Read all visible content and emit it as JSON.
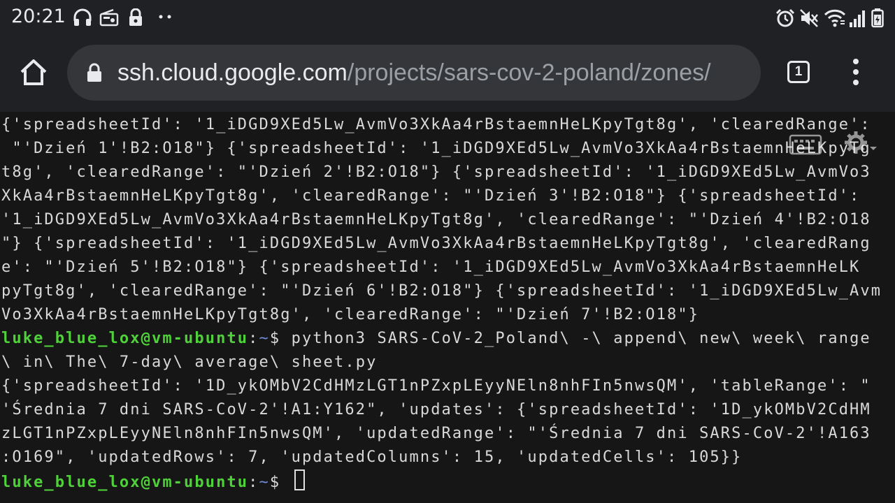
{
  "status_bar": {
    "time": "20:21",
    "left_icons": [
      "headphones-icon",
      "radio-icon",
      "lock-icon",
      "more-dots-icon"
    ],
    "right_icons": [
      "alarm-icon",
      "mute-icon",
      "wifi-icon",
      "signal-icon",
      "battery-icon"
    ]
  },
  "browser": {
    "url_host": "ssh.cloud.google.com",
    "url_path": "/projects/sars-cov-2-poland/zones/",
    "tab_count": "1"
  },
  "terminal": {
    "rows": [
      [
        {
          "t": "text",
          "v": "{'spreadsheetId': '1_iDGD9XEd5Lw_AvmVo3XkAa4rBstaemnHeLKpyTgt8g', 'clearedRange':"
        }
      ],
      [
        {
          "t": "text",
          "v": " \"'Dzień 1'!B2:O18\"} {'spreadsheetId': '1_iDGD9XEd5Lw_AvmVo3XkAa4rBstaemnHeLKpyTg"
        }
      ],
      [
        {
          "t": "text",
          "v": "t8g', 'clearedRange': \"'Dzień 2'!B2:O18\"} {'spreadsheetId': '1_iDGD9XEd5Lw_AvmVo3"
        }
      ],
      [
        {
          "t": "text",
          "v": "XkAa4rBstaemnHeLKpyTgt8g', 'clearedRange': \"'Dzień 3'!B2:O18\"} {'spreadsheetId':"
        }
      ],
      [
        {
          "t": "text",
          "v": "'1_iDGD9XEd5Lw_AvmVo3XkAa4rBstaemnHeLKpyTgt8g', 'clearedRange': \"'Dzień 4'!B2:O18"
        }
      ],
      [
        {
          "t": "text",
          "v": "\"} {'spreadsheetId': '1_iDGD9XEd5Lw_AvmVo3XkAa4rBstaemnHeLKpyTgt8g', 'clearedRang"
        }
      ],
      [
        {
          "t": "text",
          "v": "e': \"'Dzień 5'!B2:O18\"} {'spreadsheetId': '1_iDGD9XEd5Lw_AvmVo3XkAa4rBstaemnHeLK"
        }
      ],
      [
        {
          "t": "text",
          "v": "pyTgt8g', 'clearedRange': \"'Dzień 6'!B2:O18\"} {'spreadsheetId': '1_iDGD9XEd5Lw_Avm"
        }
      ],
      [
        {
          "t": "text",
          "v": "Vo3XkAa4rBstaemnHeLKpyTgt8g', 'clearedRange': \"'Dzień 7'!B2:O18\"}"
        }
      ],
      [
        {
          "t": "user",
          "v": "luke_blue_lox@vm-ubuntu"
        },
        {
          "t": "text",
          "v": ":"
        },
        {
          "t": "path",
          "v": "~"
        },
        {
          "t": "text",
          "v": "$ python3 SARS-CoV-2_Poland\\ -\\ append\\ new\\ week\\ range"
        }
      ],
      [
        {
          "t": "text",
          "v": "\\ in\\ The\\ 7-day\\ average\\ sheet.py"
        }
      ],
      [
        {
          "t": "text",
          "v": "{'spreadsheetId': '1D_ykOMbV2CdHMzLGT1nPZxpLEyyNEln8nhFIn5nwsQM', 'tableRange': \""
        }
      ],
      [
        {
          "t": "text",
          "v": "'Średnia 7 dni SARS-CoV-2'!A1:Y162\", 'updates': {'spreadsheetId': '1D_ykOMbV2CdHM"
        }
      ],
      [
        {
          "t": "text",
          "v": "zLGT1nPZxpLEyyNEln8nhFIn5nwsQM', 'updatedRange': \"'Średnia 7 dni SARS-CoV-2'!A163"
        }
      ],
      [
        {
          "t": "text",
          "v": ":O169\", 'updatedRows': 7, 'updatedColumns': 15, 'updatedCells': 105}}"
        }
      ],
      [
        {
          "t": "user",
          "v": "luke_blue_lox@vm-ubuntu"
        },
        {
          "t": "text",
          "v": ":"
        },
        {
          "t": "path",
          "v": "~"
        },
        {
          "t": "text",
          "v": "$ "
        },
        {
          "t": "cursor",
          "v": ""
        }
      ]
    ]
  },
  "colors": {
    "terminal_bg": "#161616",
    "terminal_text": "#d9d9d9",
    "prompt_user": "#4fd13a",
    "prompt_path": "#6f8dd6",
    "toolbar_bg": "#202124",
    "omnibox_bg": "#35363a"
  }
}
